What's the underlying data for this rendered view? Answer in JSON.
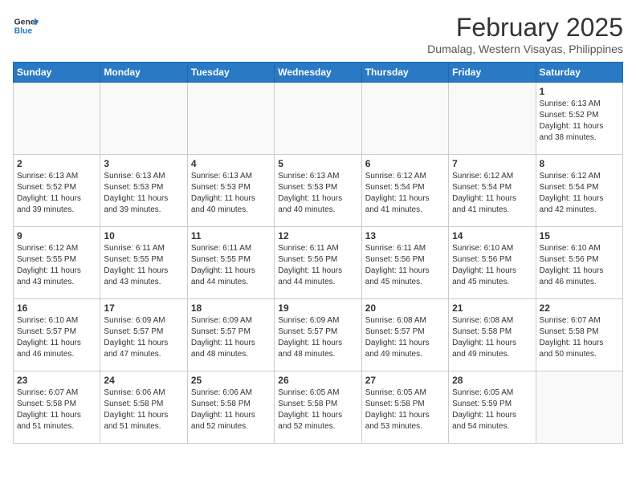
{
  "header": {
    "logo_line1": "General",
    "logo_line2": "Blue",
    "month_title": "February 2025",
    "subtitle": "Dumalag, Western Visayas, Philippines"
  },
  "days_of_week": [
    "Sunday",
    "Monday",
    "Tuesday",
    "Wednesday",
    "Thursday",
    "Friday",
    "Saturday"
  ],
  "weeks": [
    [
      {
        "day": "",
        "info": ""
      },
      {
        "day": "",
        "info": ""
      },
      {
        "day": "",
        "info": ""
      },
      {
        "day": "",
        "info": ""
      },
      {
        "day": "",
        "info": ""
      },
      {
        "day": "",
        "info": ""
      },
      {
        "day": "1",
        "info": "Sunrise: 6:13 AM\nSunset: 5:52 PM\nDaylight: 11 hours\nand 38 minutes."
      }
    ],
    [
      {
        "day": "2",
        "info": "Sunrise: 6:13 AM\nSunset: 5:52 PM\nDaylight: 11 hours\nand 39 minutes."
      },
      {
        "day": "3",
        "info": "Sunrise: 6:13 AM\nSunset: 5:53 PM\nDaylight: 11 hours\nand 39 minutes."
      },
      {
        "day": "4",
        "info": "Sunrise: 6:13 AM\nSunset: 5:53 PM\nDaylight: 11 hours\nand 40 minutes."
      },
      {
        "day": "5",
        "info": "Sunrise: 6:13 AM\nSunset: 5:53 PM\nDaylight: 11 hours\nand 40 minutes."
      },
      {
        "day": "6",
        "info": "Sunrise: 6:12 AM\nSunset: 5:54 PM\nDaylight: 11 hours\nand 41 minutes."
      },
      {
        "day": "7",
        "info": "Sunrise: 6:12 AM\nSunset: 5:54 PM\nDaylight: 11 hours\nand 41 minutes."
      },
      {
        "day": "8",
        "info": "Sunrise: 6:12 AM\nSunset: 5:54 PM\nDaylight: 11 hours\nand 42 minutes."
      }
    ],
    [
      {
        "day": "9",
        "info": "Sunrise: 6:12 AM\nSunset: 5:55 PM\nDaylight: 11 hours\nand 43 minutes."
      },
      {
        "day": "10",
        "info": "Sunrise: 6:11 AM\nSunset: 5:55 PM\nDaylight: 11 hours\nand 43 minutes."
      },
      {
        "day": "11",
        "info": "Sunrise: 6:11 AM\nSunset: 5:55 PM\nDaylight: 11 hours\nand 44 minutes."
      },
      {
        "day": "12",
        "info": "Sunrise: 6:11 AM\nSunset: 5:56 PM\nDaylight: 11 hours\nand 44 minutes."
      },
      {
        "day": "13",
        "info": "Sunrise: 6:11 AM\nSunset: 5:56 PM\nDaylight: 11 hours\nand 45 minutes."
      },
      {
        "day": "14",
        "info": "Sunrise: 6:10 AM\nSunset: 5:56 PM\nDaylight: 11 hours\nand 45 minutes."
      },
      {
        "day": "15",
        "info": "Sunrise: 6:10 AM\nSunset: 5:56 PM\nDaylight: 11 hours\nand 46 minutes."
      }
    ],
    [
      {
        "day": "16",
        "info": "Sunrise: 6:10 AM\nSunset: 5:57 PM\nDaylight: 11 hours\nand 46 minutes."
      },
      {
        "day": "17",
        "info": "Sunrise: 6:09 AM\nSunset: 5:57 PM\nDaylight: 11 hours\nand 47 minutes."
      },
      {
        "day": "18",
        "info": "Sunrise: 6:09 AM\nSunset: 5:57 PM\nDaylight: 11 hours\nand 48 minutes."
      },
      {
        "day": "19",
        "info": "Sunrise: 6:09 AM\nSunset: 5:57 PM\nDaylight: 11 hours\nand 48 minutes."
      },
      {
        "day": "20",
        "info": "Sunrise: 6:08 AM\nSunset: 5:57 PM\nDaylight: 11 hours\nand 49 minutes."
      },
      {
        "day": "21",
        "info": "Sunrise: 6:08 AM\nSunset: 5:58 PM\nDaylight: 11 hours\nand 49 minutes."
      },
      {
        "day": "22",
        "info": "Sunrise: 6:07 AM\nSunset: 5:58 PM\nDaylight: 11 hours\nand 50 minutes."
      }
    ],
    [
      {
        "day": "23",
        "info": "Sunrise: 6:07 AM\nSunset: 5:58 PM\nDaylight: 11 hours\nand 51 minutes."
      },
      {
        "day": "24",
        "info": "Sunrise: 6:06 AM\nSunset: 5:58 PM\nDaylight: 11 hours\nand 51 minutes."
      },
      {
        "day": "25",
        "info": "Sunrise: 6:06 AM\nSunset: 5:58 PM\nDaylight: 11 hours\nand 52 minutes."
      },
      {
        "day": "26",
        "info": "Sunrise: 6:05 AM\nSunset: 5:58 PM\nDaylight: 11 hours\nand 52 minutes."
      },
      {
        "day": "27",
        "info": "Sunrise: 6:05 AM\nSunset: 5:58 PM\nDaylight: 11 hours\nand 53 minutes."
      },
      {
        "day": "28",
        "info": "Sunrise: 6:05 AM\nSunset: 5:59 PM\nDaylight: 11 hours\nand 54 minutes."
      },
      {
        "day": "",
        "info": ""
      }
    ]
  ]
}
